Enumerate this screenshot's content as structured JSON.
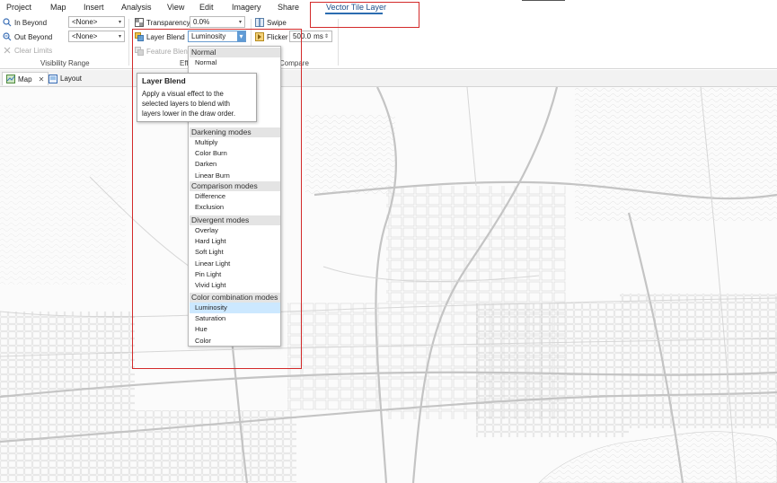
{
  "menu": {
    "project": "Project",
    "map": "Map",
    "insert": "Insert",
    "analysis": "Analysis",
    "view": "View",
    "edit": "Edit",
    "imagery": "Imagery",
    "share": "Share",
    "vector_tile_layer": "Vector Tile Layer"
  },
  "ribbon": {
    "in_beyond_label": "In Beyond",
    "in_beyond_value": "<None>",
    "out_beyond_label": "Out Beyond",
    "out_beyond_value": "<None>",
    "clear_limits_label": "Clear Limits",
    "visibility_range_group": "Visibility Range",
    "transparency_label": "Transparency",
    "transparency_value": "0.0%",
    "layer_blend_label": "Layer Blend",
    "layer_blend_value": "Luminosity",
    "feature_blend_label": "Feature Blend",
    "effects_group_partial": "Eff",
    "swipe_label": "Swipe",
    "flicker_label": "Flicker",
    "flicker_value": "500.0",
    "flicker_unit": "ms",
    "compare_group_partial": "Compare"
  },
  "views": {
    "map_tab": "Map",
    "layout_tab": "Layout"
  },
  "dropdown": {
    "groups": [
      {
        "header": "Normal",
        "items": [
          "Normal"
        ]
      },
      {
        "header": "Darkening modes",
        "items": [
          "Multiply",
          "Color Burn",
          "Darken",
          "Linear Burn"
        ]
      },
      {
        "header": "Comparison modes",
        "items": [
          "Difference",
          "Exclusion"
        ]
      },
      {
        "header": "Divergent modes",
        "items": [
          "Overlay",
          "Hard Light",
          "Soft Light",
          "Linear Light",
          "Pin Light",
          "Vivid Light"
        ]
      },
      {
        "header": "Color combination modes",
        "items": [
          "Luminosity",
          "Saturation",
          "Hue",
          "Color"
        ]
      }
    ],
    "selected": "Luminosity"
  },
  "tooltip": {
    "title": "Layer Blend",
    "body_line1": "Apply a visual effect to the",
    "body_line2": "selected layers to blend with",
    "body_line3": "layers lower in the draw order."
  },
  "colors": {
    "highlight_red": "#d32a2a",
    "selection_blue": "#cce8ff",
    "tab_underline": "#2b6cb0"
  },
  "icons": [
    "in-beyond-icon",
    "out-beyond-icon",
    "clear-limits-icon",
    "transparency-icon",
    "layer-blend-icon",
    "feature-blend-icon",
    "swipe-icon",
    "flicker-icon",
    "map-tab-icon",
    "layout-tab-icon",
    "close-icon"
  ]
}
